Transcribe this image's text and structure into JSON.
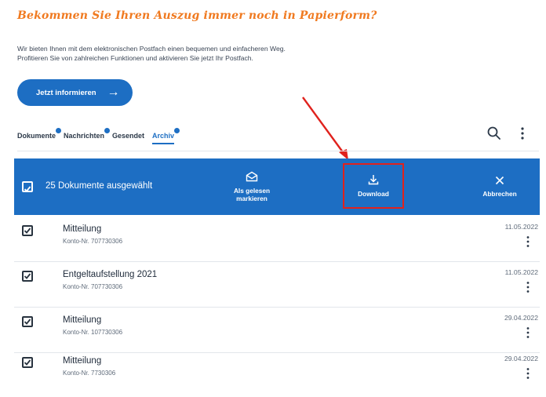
{
  "promo": {
    "title": "Bekommen Sie Ihren Auszug immer noch in Papierform?",
    "text_line1": "Wir bieten Ihnen mit dem elektronischen Postfach einen bequemen und einfacheren Weg.",
    "text_line2": "Profitieren Sie von zahlreichen Funktionen und aktivieren Sie jetzt Ihr Postfach.",
    "button_label": "Jetzt informieren",
    "button_arrow": "→"
  },
  "tabs": [
    {
      "label": "Dokumente",
      "badge": true,
      "active": false
    },
    {
      "label": "Nachrichten",
      "badge": true,
      "active": false
    },
    {
      "label": "Gesendet",
      "badge": false,
      "active": false
    },
    {
      "label": "Archiv",
      "badge": true,
      "active": true
    }
  ],
  "action_bar": {
    "selected_text": "25 Dokumente ausgewählt",
    "mark_read_line1": "Als gelesen",
    "mark_read_line2": "markieren",
    "download_label": "Download",
    "cancel_label": "Abbrechen"
  },
  "documents": [
    {
      "title": "Mitteilung",
      "account": "Konto-Nr. 707730306",
      "date": "11.05.2022",
      "checked": true
    },
    {
      "title": "Entgeltaufstellung 2021",
      "account": "Konto-Nr. 707730306",
      "date": "11.05.2022",
      "checked": true
    },
    {
      "title": "Mitteilung",
      "account": "Konto-Nr. 107730306",
      "date": "29.04.2022",
      "checked": true
    },
    {
      "title": "Mitteilung",
      "account": "Konto-Nr. 7730306",
      "date": "29.04.2022",
      "checked": true
    }
  ],
  "colors": {
    "brand_blue": "#1d6ec3",
    "promo_orange": "#f07a20",
    "highlight_red": "#e0221d"
  },
  "icons": {
    "search": "search-icon",
    "more": "more-vertical-icon",
    "envelope_open": "envelope-open-icon",
    "download": "download-icon",
    "close": "close-icon",
    "checkbox": "checkbox-checked-icon",
    "arrow": "arrow-right-icon"
  }
}
